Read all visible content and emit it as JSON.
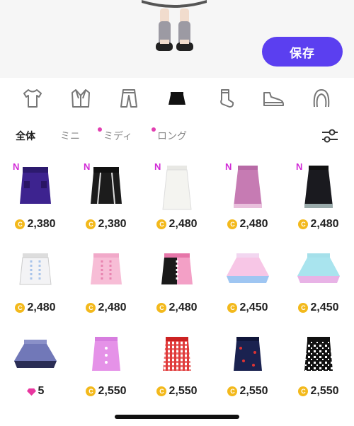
{
  "header": {
    "save_label": "保存"
  },
  "categories": [
    {
      "icon": "tshirt-icon",
      "active": false
    },
    {
      "icon": "jacket-icon",
      "active": false
    },
    {
      "icon": "pants-icon",
      "active": false
    },
    {
      "icon": "skirt-icon",
      "active": true
    },
    {
      "icon": "socks-icon",
      "active": false
    },
    {
      "icon": "sneaker-icon",
      "active": false
    },
    {
      "icon": "hair-icon",
      "active": false
    }
  ],
  "filters": {
    "all": "全体",
    "mini": "ミニ",
    "midi": "ミディ",
    "long": "ロング"
  },
  "colors": {
    "accent": "#5b3ff0",
    "new_badge": "#d12ad6",
    "coin": "#f3b91c",
    "gem": "#e8379f"
  },
  "items": [
    {
      "badge": "N",
      "price": "2,380",
      "currency": "coin"
    },
    {
      "badge": "N",
      "price": "2,380",
      "currency": "coin"
    },
    {
      "badge": "N",
      "price": "2,480",
      "currency": "coin"
    },
    {
      "badge": "N",
      "price": "2,480",
      "currency": "coin"
    },
    {
      "badge": "N",
      "price": "2,480",
      "currency": "coin"
    },
    {
      "badge": "",
      "price": "2,480",
      "currency": "coin"
    },
    {
      "badge": "",
      "price": "2,480",
      "currency": "coin"
    },
    {
      "badge": "",
      "price": "2,480",
      "currency": "coin"
    },
    {
      "badge": "",
      "price": "2,450",
      "currency": "coin"
    },
    {
      "badge": "",
      "price": "2,450",
      "currency": "coin"
    },
    {
      "badge": "",
      "price": "5",
      "currency": "gem"
    },
    {
      "badge": "",
      "price": "2,550",
      "currency": "coin"
    },
    {
      "badge": "",
      "price": "2,550",
      "currency": "coin"
    },
    {
      "badge": "",
      "price": "2,550",
      "currency": "coin"
    },
    {
      "badge": "",
      "price": "2,550",
      "currency": "coin"
    }
  ],
  "coin_glyph": "C"
}
